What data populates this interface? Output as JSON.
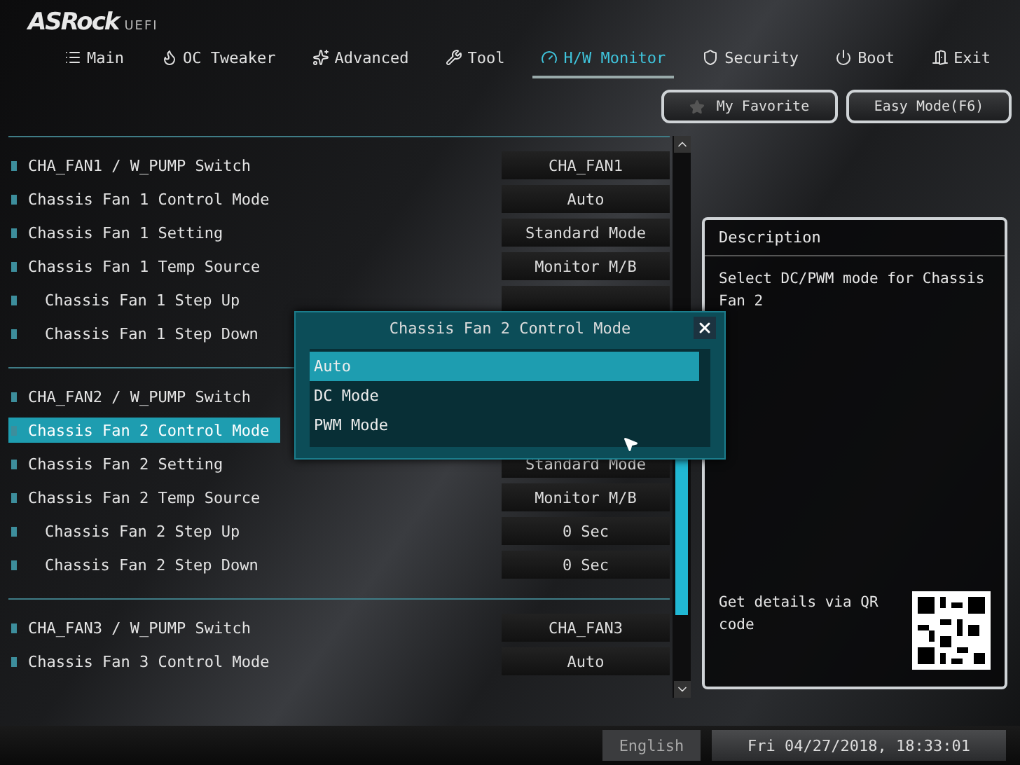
{
  "brand": {
    "logo": "ASRock",
    "suffix": "UEFI"
  },
  "tabs": [
    {
      "label": "Main",
      "selected": false
    },
    {
      "label": "OC Tweaker",
      "selected": false
    },
    {
      "label": "Advanced",
      "selected": false
    },
    {
      "label": "Tool",
      "selected": false
    },
    {
      "label": "H/W Monitor",
      "selected": true
    },
    {
      "label": "Security",
      "selected": false
    },
    {
      "label": "Boot",
      "selected": false
    },
    {
      "label": "Exit",
      "selected": false
    }
  ],
  "quick_buttons": [
    "My Favorite",
    "Easy Mode(F6)"
  ],
  "settings_groups": [
    {
      "rows": [
        {
          "label": "CHA_FAN1 / W_PUMP Switch",
          "value": "CHA_FAN1",
          "kind": "item",
          "selected": false
        },
        {
          "label": "Chassis Fan 1 Control Mode",
          "value": "Auto",
          "kind": "item",
          "selected": false
        },
        {
          "label": "Chassis Fan 1 Setting",
          "value": "Standard Mode",
          "kind": "item",
          "selected": false
        },
        {
          "label": "Chassis Fan 1 Temp Source",
          "value": "Monitor M/B",
          "kind": "item",
          "selected": false
        },
        {
          "label": "Chassis Fan 1 Step Up",
          "kind": "subitem",
          "selected": false
        },
        {
          "label": "Chassis Fan 1 Step Down",
          "kind": "subitem",
          "selected": false
        }
      ]
    },
    {
      "rows": [
        {
          "label": "CHA_FAN2 / W_PUMP Switch",
          "kind": "item",
          "selected": false
        },
        {
          "label": "Chassis Fan 2 Control Mode",
          "kind": "item",
          "selected": true
        },
        {
          "label": "Chassis Fan 2 Setting",
          "value": "Standard Mode",
          "kind": "item",
          "selected": false
        },
        {
          "label": "Chassis Fan 2 Temp Source",
          "value": "Monitor M/B",
          "kind": "item",
          "selected": false
        },
        {
          "label": "Chassis Fan 2 Step Up",
          "value": "0 Sec",
          "kind": "subitem",
          "selected": false
        },
        {
          "label": "Chassis Fan 2 Step Down",
          "value": "0 Sec",
          "kind": "subitem",
          "selected": false
        }
      ]
    },
    {
      "rows": [
        {
          "label": "CHA_FAN3 / W_PUMP Switch",
          "value": "CHA_FAN3",
          "kind": "item",
          "selected": false
        },
        {
          "label": "Chassis Fan 3 Control Mode",
          "value": "Auto",
          "kind": "item",
          "selected": false
        }
      ]
    }
  ],
  "popup": {
    "title": "Chassis Fan 2 Control Mode",
    "options": [
      {
        "label": "Auto",
        "selected": true
      },
      {
        "label": "DC Mode",
        "selected": false
      },
      {
        "label": "PWM Mode",
        "selected": false
      }
    ]
  },
  "description": {
    "title": "Description",
    "text": "Select DC/PWM mode for Chassis Fan 2",
    "qr_text": "Get details via QR code"
  },
  "status_bar": {
    "language": "English",
    "datetime": "Fri 04/27/2018, 18:33:01"
  }
}
